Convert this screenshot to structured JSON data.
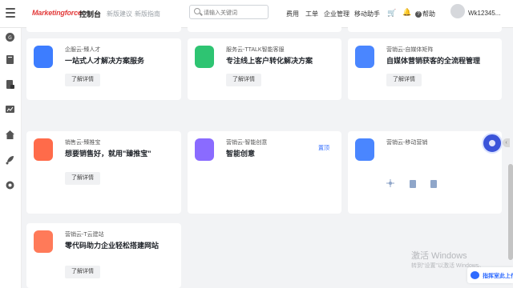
{
  "header": {
    "brand_main": "Marketingforce",
    "title": "控制台",
    "links": [
      "新版建议",
      "新版指南"
    ],
    "search_placeholder": "请输入关键词",
    "nav": [
      "费用",
      "工单",
      "企业管理",
      "移动助手"
    ],
    "help_label": "帮助",
    "username": "Wk12345..."
  },
  "sidebar": {
    "icons": [
      "menu-icon",
      "chatgpt-icon",
      "book-icon",
      "document-lock-icon",
      "chart-icon",
      "home-icon",
      "rocket-icon",
      "settings-icon"
    ]
  },
  "cards": [
    {
      "category": "企服云-臻人才",
      "title": "一站式人才解决方案服务",
      "button": "了解详情",
      "color": "#3d7dff"
    },
    {
      "category": "服务云-TTALK智能客服",
      "title": "专注线上客户转化解决方案",
      "button": "了解详情",
      "color": "#2ec472"
    },
    {
      "category": "营销云-自媒体矩阵",
      "title": "自媒体营销获客的全流程管理",
      "button": "了解详情",
      "color": "#4a86ff"
    },
    {
      "category": "销售云-臻推宝",
      "title": "想要销售好，就用\"臻推宝\"",
      "button": "了解详情",
      "color": "#ff6b4a"
    },
    {
      "category": "营销云-智能创意",
      "title": "智能创意",
      "badge": "置顶",
      "color": "#8a6bff"
    },
    {
      "category": "营销云-移动营销",
      "title": "",
      "color": "#4a86ff"
    },
    {
      "category": "营销云-T云建站",
      "title": "零代码助力企业轻松搭建网站",
      "button": "了解详情",
      "color": "#ff7a59"
    }
  ],
  "watermark": {
    "line1": "激活 Windows",
    "line2": "转到\"设置\"以激活 Windows。"
  },
  "feedback_label": "指挥室此上传"
}
